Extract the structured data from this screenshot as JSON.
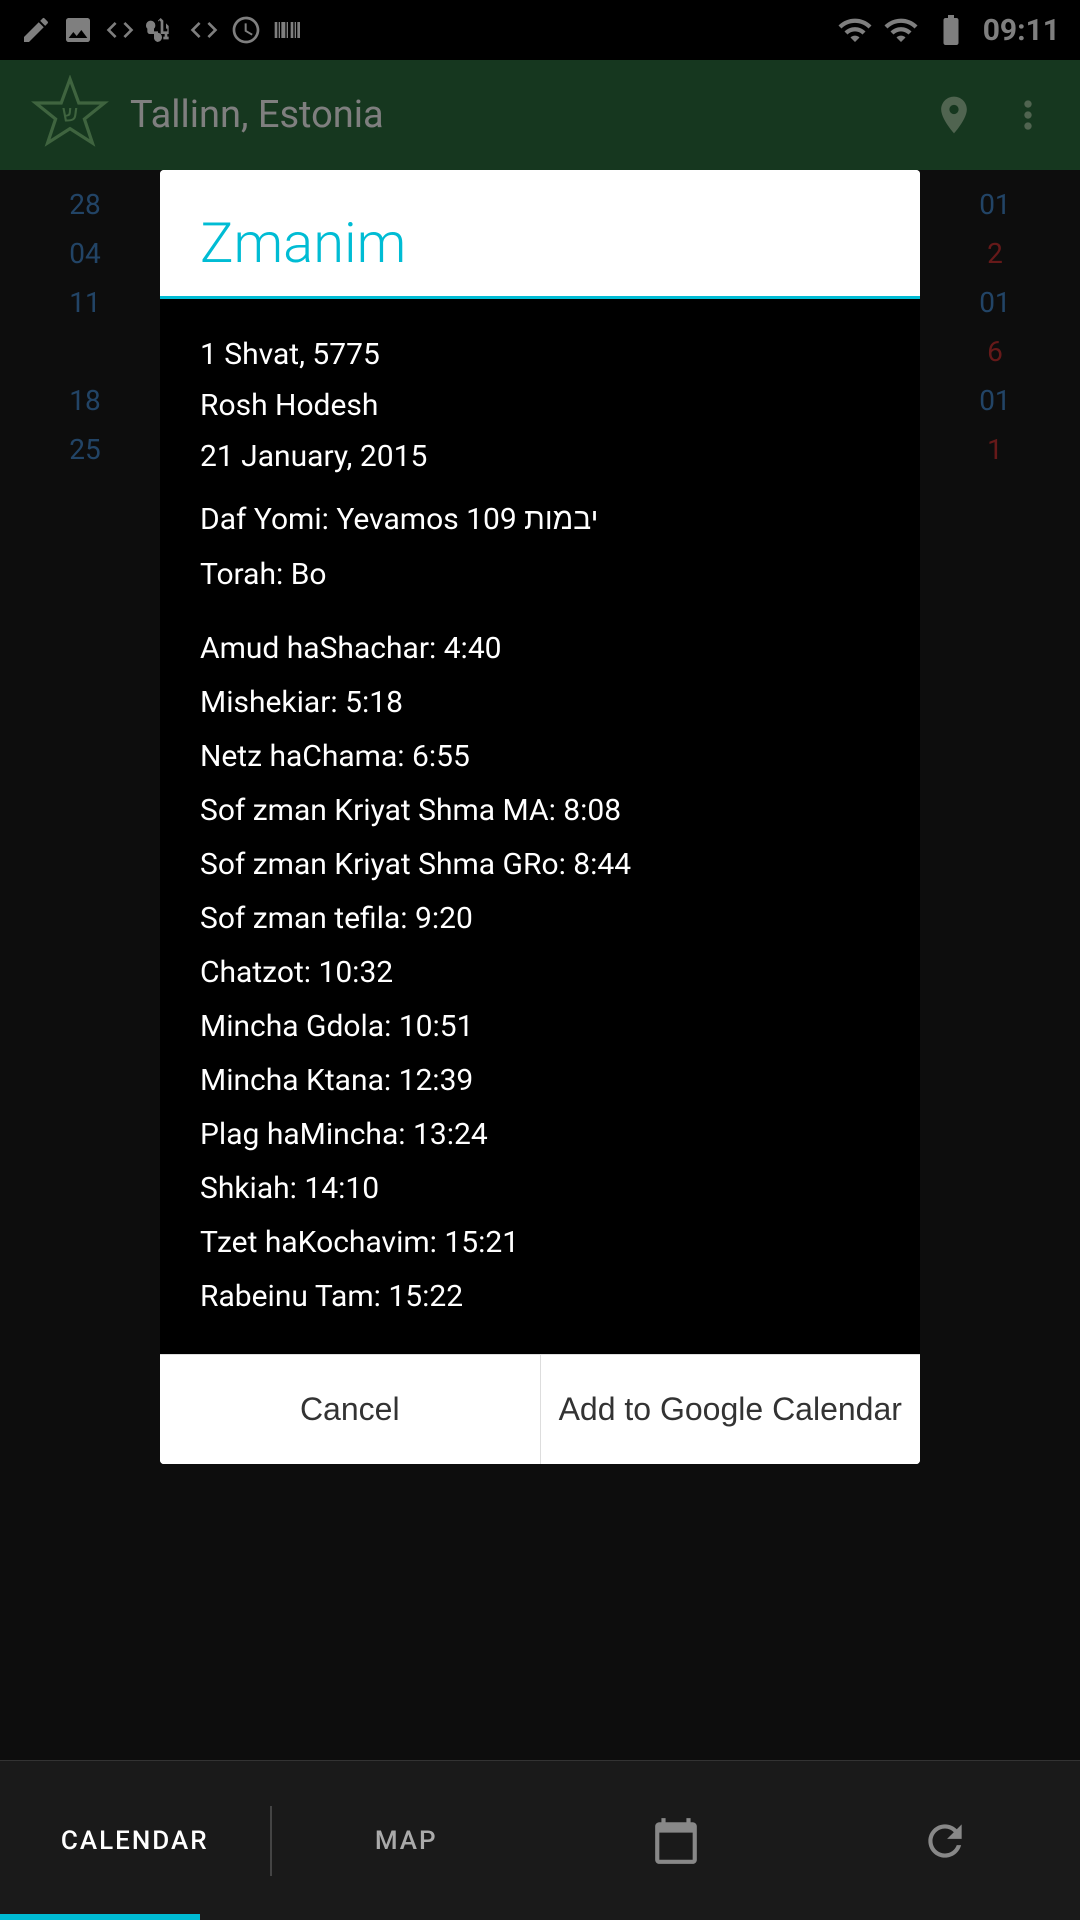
{
  "statusBar": {
    "time": "09:11",
    "icons": [
      "edit-icon",
      "image-icon",
      "code-icon",
      "usb-icon",
      "code2-icon",
      "clock-icon",
      "barcode-icon"
    ]
  },
  "header": {
    "location": "Tallinn, Estonia",
    "logoAlt": "Jewish Calendar Logo"
  },
  "dialog": {
    "title": "Zmanim",
    "date_hebrew": "1 Shvat, 5775",
    "rosh_hodesh": "Rosh Hodesh",
    "date_gregorian": "21 January, 2015",
    "daf_yomi": "Daf Yomi: Yevamos 109 יבמות",
    "torah": "Torah: Bo",
    "times": [
      "Amud haShachar: 4:40",
      "Mishekiar: 5:18",
      "Netz haChama: 6:55",
      "Sof zman Kriyat Shma MA: 8:08",
      "Sof zman Kriyat Shma GRo: 8:44",
      "Sof zman tefila: 9:20",
      "Chatzot: 10:32",
      "Mincha Gdola: 10:51",
      "Mincha Ktana: 12:39",
      "Plag haMincha: 13:24",
      "Shkiah: 14:10",
      "Tzet haKochavim: 15:21",
      "Rabeinu Tam: 15:22"
    ],
    "cancel_label": "Cancel",
    "add_calendar_label": "Add to Google Calendar"
  },
  "bottomNav": {
    "items": [
      {
        "label": "CALENDAR",
        "active": true
      },
      {
        "label": "MAP",
        "active": false
      }
    ]
  }
}
